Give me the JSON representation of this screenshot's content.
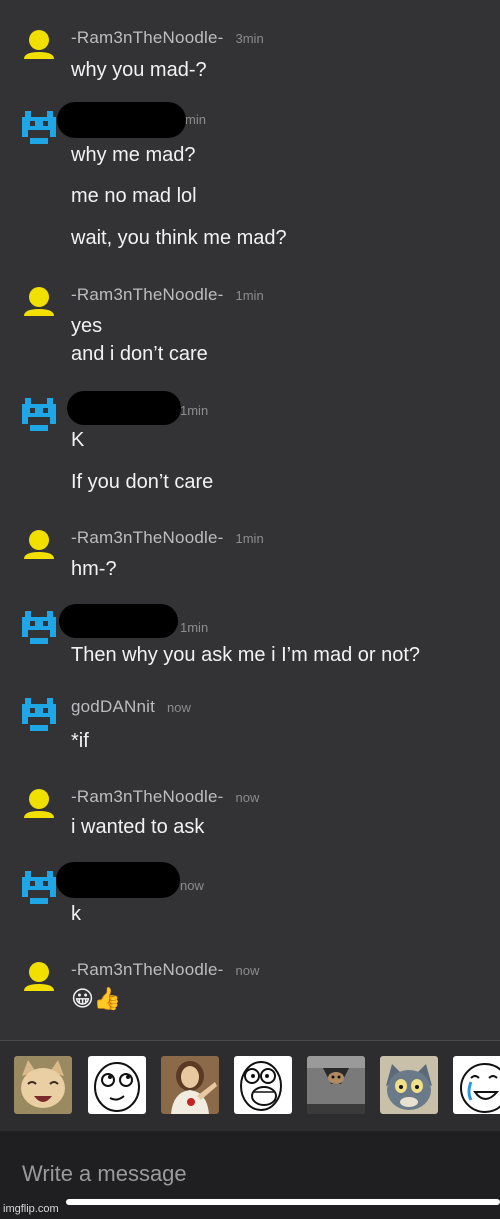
{
  "colors": {
    "background": "#333335",
    "user_avatar": "#f1df00",
    "robot_avatar": "#1ea6e6",
    "redaction": "#000000"
  },
  "messages": [
    {
      "avatar": "user-avatar-icon",
      "author": "-Ram3nTheNoodle-",
      "time": "3min",
      "lines": [
        "why you mad-?"
      ]
    },
    {
      "avatar": "robot-avatar-icon",
      "author": "",
      "time": "min",
      "lines": [
        "why me mad?",
        "me no mad lol",
        "wait, you think me mad?"
      ]
    },
    {
      "avatar": "user-avatar-icon",
      "author": "-Ram3nTheNoodle-",
      "time": "1min",
      "lines": [
        "yes",
        "and i don’t care"
      ]
    },
    {
      "avatar": "robot-avatar-icon",
      "author": "",
      "time": "1min",
      "lines": [
        "K",
        "If you don’t care"
      ]
    },
    {
      "avatar": "user-avatar-icon",
      "author": "-Ram3nTheNoodle-",
      "time": "1min",
      "lines": [
        "hm-?"
      ]
    },
    {
      "avatar": "robot-avatar-icon",
      "author": "",
      "time": "1min",
      "lines": [
        "Then why you ask me i I’m mad or not?"
      ]
    },
    {
      "avatar": "robot-avatar-icon",
      "author": "godDANnit",
      "time": "now",
      "lines": [
        "*if"
      ]
    },
    {
      "avatar": "user-avatar-icon",
      "author": "-Ram3nTheNoodle-",
      "time": "now",
      "lines": [
        "i wanted to ask"
      ]
    },
    {
      "avatar": "robot-avatar-icon",
      "author": "",
      "time": "now",
      "lines": [
        "k"
      ]
    },
    {
      "avatar": "user-avatar-icon",
      "author": "-Ram3nTheNoodle-",
      "time": "now",
      "lines": [
        "😀👍"
      ]
    }
  ],
  "stickers": [
    {
      "icon": "happy-cat-sticker-icon"
    },
    {
      "icon": "thinking-rage-face-sticker-icon"
    },
    {
      "icon": "buddy-christ-sticker-icon"
    },
    {
      "icon": "lol-rage-face-sticker-icon"
    },
    {
      "icon": "ceiling-cat-sticker-icon"
    },
    {
      "icon": "unsettled-tom-sticker-icon"
    },
    {
      "icon": "tears-of-joy-rage-face-sticker-icon"
    }
  ],
  "composer": {
    "placeholder": "Write a message"
  },
  "watermark": "imgflip.com"
}
